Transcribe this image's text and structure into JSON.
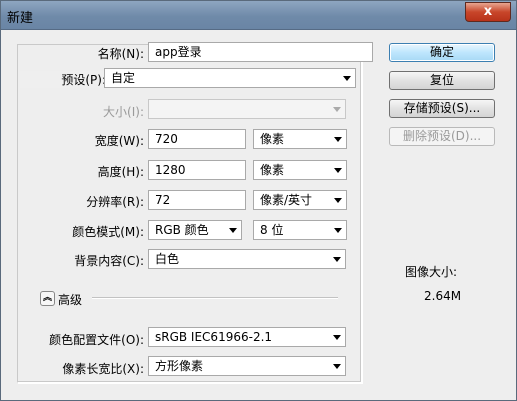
{
  "window": {
    "title": "新建",
    "close_label": "x"
  },
  "form": {
    "name_label": "名称(N):",
    "name_value": "app登录",
    "preset_label": "预设(P):",
    "preset_value": "自定",
    "size_label": "大小(I):",
    "size_value": "",
    "width_label": "宽度(W):",
    "width_value": "720",
    "width_unit": "像素",
    "height_label": "高度(H):",
    "height_value": "1280",
    "height_unit": "像素",
    "resolution_label": "分辨率(R):",
    "resolution_value": "72",
    "resolution_unit": "像素/英寸",
    "color_mode_label": "颜色模式(M):",
    "color_mode_value": "RGB 颜色",
    "bit_depth_value": "8 位",
    "background_label": "背景内容(C):",
    "background_value": "白色",
    "advanced_label": "高级",
    "color_profile_label": "颜色配置文件(O):",
    "color_profile_value": "sRGB IEC61966-2.1",
    "pixel_aspect_label": "像素长宽比(X):",
    "pixel_aspect_value": "方形像素"
  },
  "buttons": {
    "ok": "确定",
    "reset": "复位",
    "save_preset": "存储预设(S)...",
    "delete_preset": "删除预设(D)..."
  },
  "image_size": {
    "label": "图像大小:",
    "value": "2.64M"
  }
}
